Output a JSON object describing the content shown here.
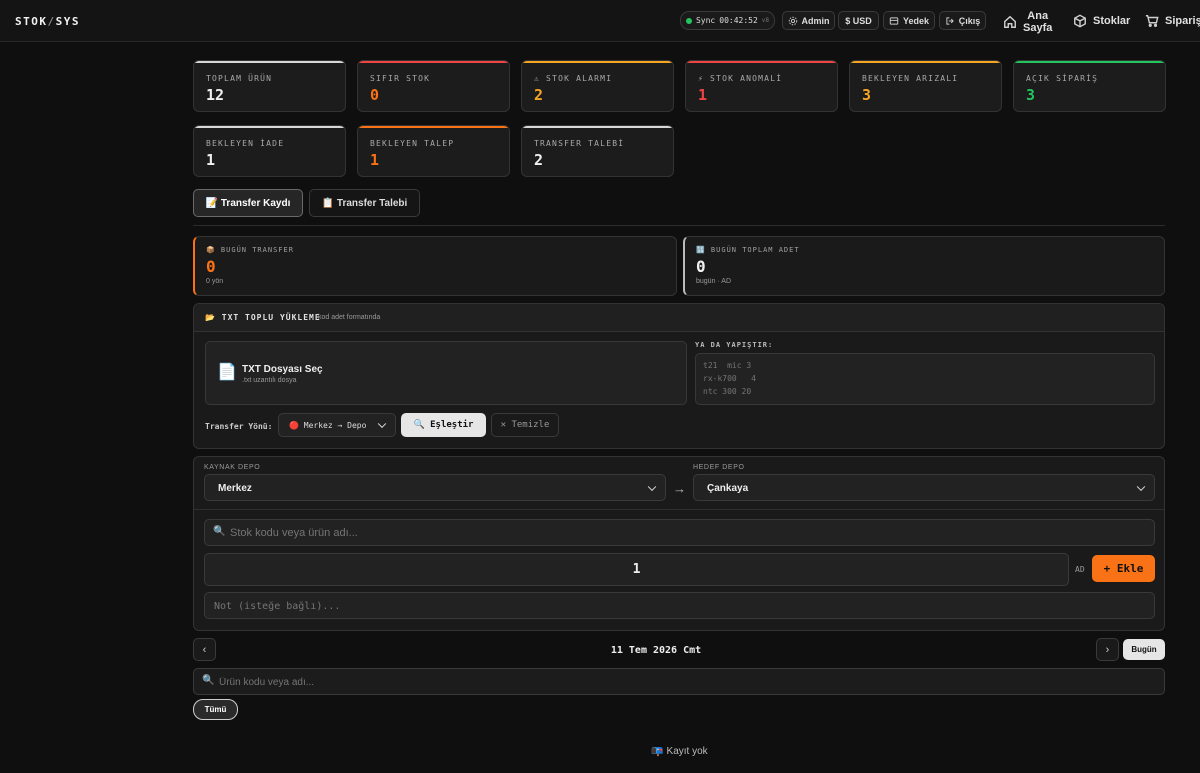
{
  "app": {
    "logo_a": "STOK",
    "logo_sep": "/",
    "logo_b": "SYS"
  },
  "topbar": {
    "sync_label": "Sync",
    "sync_time": "00:42:52",
    "sync_version": "v8",
    "admin_label": "Admin",
    "currency_label": "$ USD",
    "backup_label": "Yedek",
    "logout_label": "Çıkış",
    "nav": [
      {
        "label_line1": "Ana",
        "label_line2": "Sayfa",
        "icon": "home-icon"
      },
      {
        "label": "Stoklar",
        "icon": "box-icon"
      },
      {
        "label": "Sipariş",
        "icon": "cart-icon"
      }
    ]
  },
  "colors": {
    "orange": "#f97316",
    "amber": "#f5a524",
    "red": "#ef4444",
    "green": "#22c55e",
    "white": "#e8e8e8"
  },
  "stats": [
    {
      "label": "TOPLAM ÜRÜN",
      "value": "12",
      "accent": "#d8d8d8",
      "color": "#f0f0f0"
    },
    {
      "label": "SIFIR STOK",
      "value": "0",
      "accent": "#ef4444",
      "color": "#f97316"
    },
    {
      "label": "⚠ STOK ALARMI",
      "value": "2",
      "accent": "#f5a524",
      "color": "#f5a524"
    },
    {
      "label": "⚡ STOK ANOMALİ",
      "value": "1",
      "accent": "#ef4444",
      "color": "#ef4444"
    },
    {
      "label": "BEKLEYEN ARIZALI",
      "value": "3",
      "accent": "#f5a524",
      "color": "#f5a524"
    },
    {
      "label": "AÇIK SİPARİŞ",
      "value": "3",
      "accent": "#22c55e",
      "color": "#22c55e"
    },
    {
      "label": "BEKLEYEN İADE",
      "value": "1",
      "accent": "#d8d8d8",
      "color": "#f0f0f0"
    },
    {
      "label": "BEKLEYEN TALEP",
      "value": "1",
      "accent": "#f97316",
      "color": "#f97316"
    },
    {
      "label": "TRANSFER TALEBİ",
      "value": "2",
      "accent": "#d8d8d8",
      "color": "#f0f0f0"
    }
  ],
  "tabs": [
    {
      "label": "📝 Transfer Kaydı"
    },
    {
      "label": "📋 Transfer Talebi"
    }
  ],
  "summary": {
    "today_transfer": {
      "label": "📦 BUGÜN TRANSFER",
      "value": "0",
      "sub": "0 yön"
    },
    "today_total": {
      "label": "🔢 BUGÜN TOPLAM ADET",
      "value": "0",
      "sub": "bugün · AD"
    }
  },
  "bulk": {
    "title": "📂 TXT TOPLU YÜKLEME",
    "hint": "kod adet formatında",
    "file_icon": "📄",
    "file_title": "TXT Dosyası Seç",
    "file_sub": ".txt uzantılı dosya",
    "paste_label": "YA DA YAPIŞTIR:",
    "paste_placeholder": "t21  mic 3\nrx-k700   4\nntc 300 20",
    "direction_label": "Transfer Yönü:",
    "direction_value": "🔴 Merkez → Depo",
    "match_button": "🔍 Eşleştir",
    "clear_button": "✕ Temizle"
  },
  "form": {
    "source_label": "KAYNAK DEPO",
    "source_value": "Merkez",
    "arrow": "→",
    "target_label": "HEDEF DEPO",
    "target_value": "Çankaya",
    "search_placeholder": "Stok kodu veya ürün adı...",
    "quantity": "1",
    "unit": "AD",
    "add_button": "+ Ekle",
    "note_placeholder": "Not (isteğe bağlı)..."
  },
  "datebar": {
    "prev": "‹",
    "date": "11 Tem 2026 Cmt",
    "next": "›",
    "today_button": "Bugün"
  },
  "filter": {
    "search_placeholder": "Ürün kodu veya adı...",
    "all_button": "Tümü"
  },
  "empty": {
    "text": "📭 Kayıt yok"
  }
}
